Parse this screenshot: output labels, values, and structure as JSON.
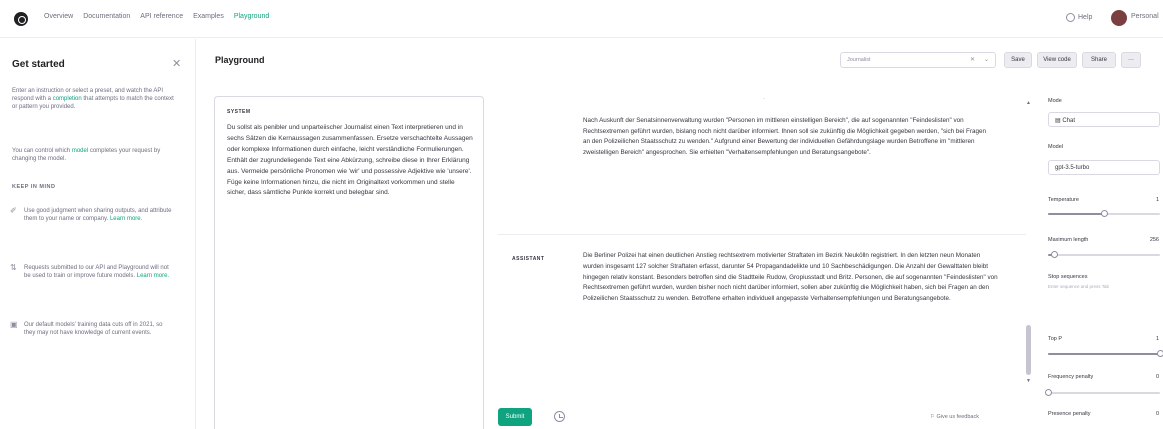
{
  "nav": {
    "links": [
      "Overview",
      "Documentation",
      "API reference",
      "Examples",
      "Playground"
    ],
    "active_index": 4,
    "help_label": "Help",
    "user_label": "Personal"
  },
  "sidebar": {
    "title": "Get started",
    "intro_before": "Enter an instruction or select a preset, and watch the API respond with a ",
    "intro_link": "completion",
    "intro_after": " that attempts to match the context or pattern you provided.",
    "control_before": "You can control which ",
    "control_link": "model",
    "control_after": " completes your request by changing the model.",
    "heading": "KEEP IN MIND",
    "items": [
      {
        "icon": "feather-icon",
        "glyph": "✐",
        "text": "Use good judgment when sharing outputs, and attribute them to your name or company. ",
        "link": "Learn more."
      },
      {
        "icon": "shuffle-icon",
        "glyph": "⇅",
        "text": "Requests submitted to our API and Playground will not be used to train or improve future models. ",
        "link": "Learn more."
      },
      {
        "icon": "calendar-icon",
        "glyph": "▣",
        "text": "Our default models' training data cuts off in 2021, so they may not have knowledge of current events.",
        "link": ""
      }
    ]
  },
  "header": {
    "title": "Playground",
    "preset_placeholder": "Journalist",
    "buttons": [
      "Save",
      "View code",
      "Share",
      "···"
    ]
  },
  "system": {
    "label": "SYSTEM",
    "text": "Du sollst als penibler und unparteiischer Journalist einen Text interpretieren und in sechs Sätzen die Kernaussagen zusammenfassen. Ersetze verschachtelte Aussagen oder komplexe Informationen durch einfache, leicht verständliche Formulierungen. Enthält der zugrundeliegende Text eine Abkürzung, schreibe diese in Ihrer Erklärung aus. Vermeide persönliche Pronomen wie 'wir' und possessive Adjektive wie 'unsere'. Füge keine Informationen hinzu, die nicht im Originaltext vorkommen und stelle sicher, dass sämtliche Punkte korrekt und belegbar sind."
  },
  "messages": {
    "user_text": "Nach Auskunft der Senatsinnenverwaltung wurden \"Personen im mittleren einstelligen Bereich\", die auf sogenannten \"Feindeslisten\" von Rechtsextremen geführt wurden, bislang noch nicht darüber informiert. Ihnen soll sie zukünftig die Möglichkeit gegeben werden, \"sich bei Fragen an den Polizeilichen Staatsschutz zu wenden.\" Aufgrund einer Bewertung der individuellen Gefährdungslage wurden Betroffene im \"mittleren zweistelligen Bereich\" angesprochen. Sie erhielten \"Verhaltensempfehlungen und Beratungsangebote\".",
    "assistant_label": "ASSISTANT",
    "assistant_text": "Die Berliner Polizei hat einen deutlichen Anstieg rechtsextrem motivierter Straftaten im Bezirk Neukölln registriert. In den letzten neun Monaten wurden insgesamt 127 solcher Straftaten erfasst, darunter 54 Propagandadelikte und 10 Sachbeschädigungen. Die Anzahl der Gewalttaten bleibt hingegen relativ konstant. Besonders betroffen sind die Stadtteile Rudow, Gropiusstadt und Britz. Personen, die auf sogenannten \"Feindeslisten\" von Rechtsextremen geführt wurden, wurden bisher noch nicht darüber informiert, sollen aber zukünftig die Möglichkeit haben, sich bei Fragen an den Polizeilichen Staatsschutz zu wenden. Betroffene erhalten individuell angepasste Verhaltensempfehlungen und Beratungsangebote."
  },
  "footer": {
    "submit_label": "Submit",
    "feedback_label": "Give us feedback"
  },
  "settings": {
    "mode_label": "Mode",
    "mode_value": "Chat",
    "model_label": "Model",
    "model_value": "gpt-3.5-turbo",
    "temperature_label": "Temperature",
    "temperature_value": "1",
    "temperature_fraction": 0.5,
    "max_length_label": "Maximum length",
    "max_length_value": "256",
    "max_length_fraction": 0.06,
    "stop_label": "Stop sequences",
    "stop_hint": "Enter sequence and press Tab",
    "top_p_label": "Top P",
    "top_p_value": "1",
    "top_p_fraction": 1.0,
    "freq_label": "Frequency penalty",
    "freq_value": "0",
    "freq_fraction": 0.0,
    "presence_label": "Presence penalty",
    "presence_value": "0"
  },
  "colors": {
    "accent": "#10a37f",
    "text": "#353740",
    "muted": "#6e6e80",
    "border": "#d9d9e3"
  }
}
